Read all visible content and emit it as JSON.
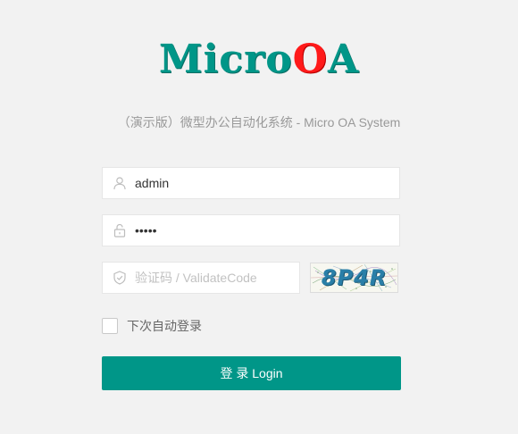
{
  "logo": {
    "part1": "Micro",
    "part2": "OA"
  },
  "subtitle": "（演示版）微型办公自动化系统 - Micro OA System",
  "username": {
    "value": "admin",
    "icon": "user-icon"
  },
  "password": {
    "value": "12345",
    "icon": "lock-icon"
  },
  "captcha": {
    "placeholder": "验证码 / ValidateCode",
    "icon": "shield-check-icon",
    "image_text": "8P4R"
  },
  "remember": {
    "label": "下次自动登录",
    "checked": false
  },
  "login_button": {
    "label": "登 录 Login"
  },
  "colors": {
    "brand": "#009688",
    "accent": "#ff1a1a",
    "background": "#f2f2f2"
  }
}
